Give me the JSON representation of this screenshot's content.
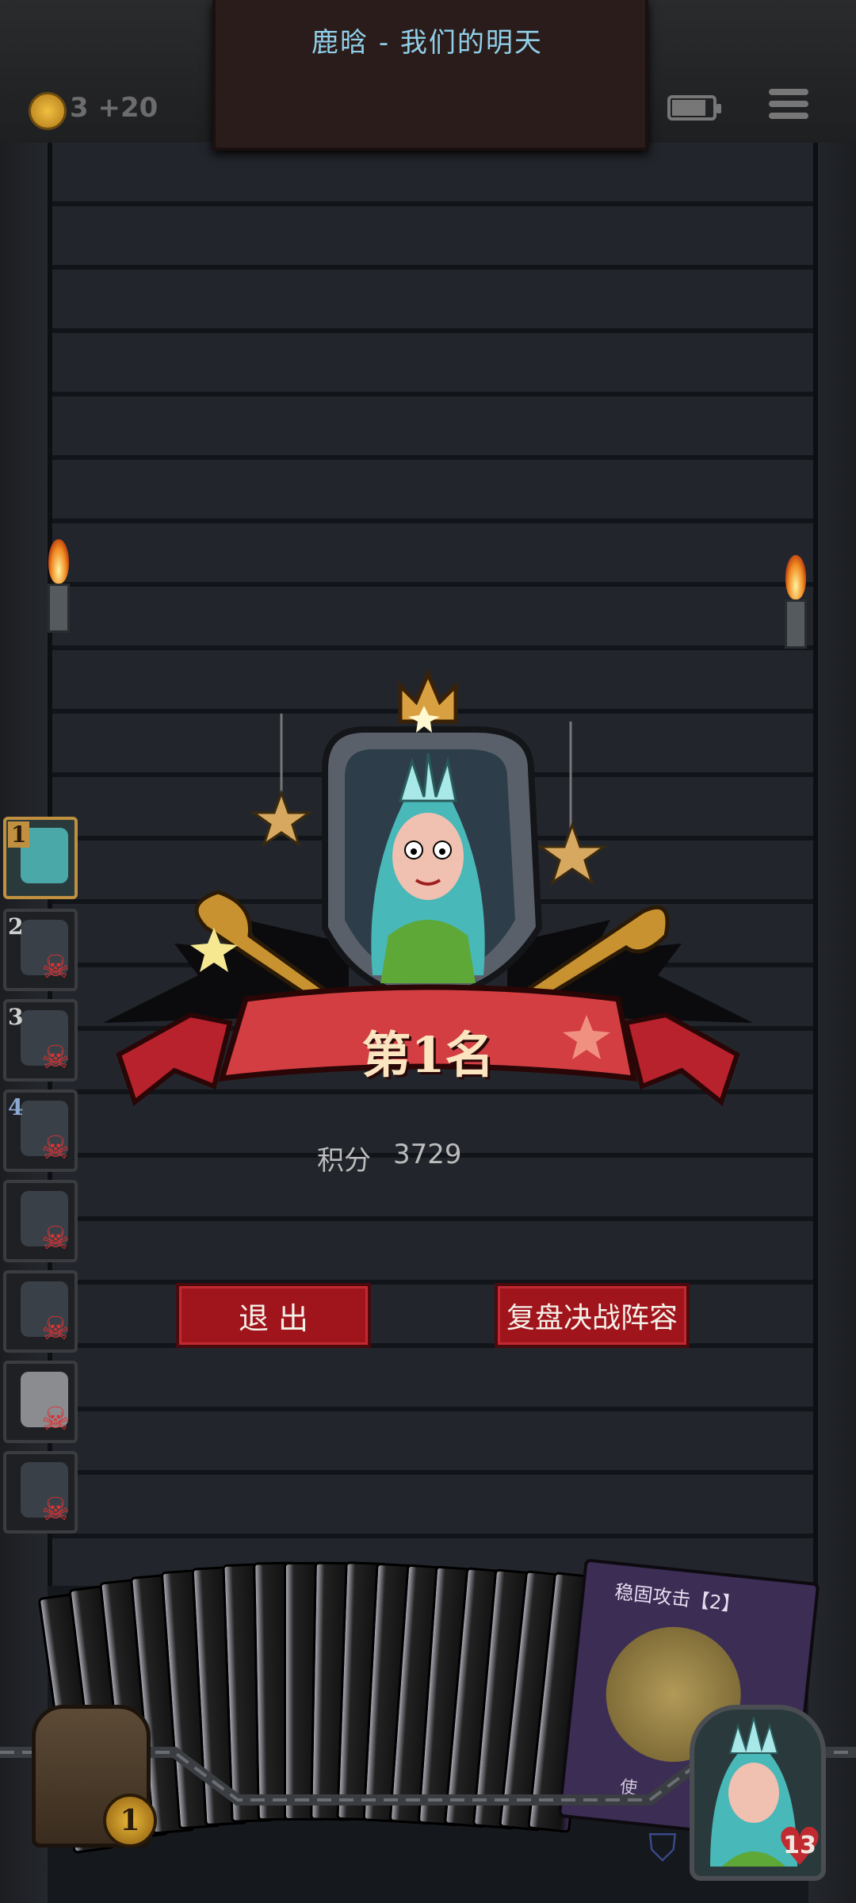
{
  "header": {
    "song_title": "鹿晗 - 我们的明天",
    "coins": "3",
    "coins_bonus": "+20"
  },
  "players": [
    {
      "rank": "1",
      "eliminated": false
    },
    {
      "rank": "2",
      "eliminated": true
    },
    {
      "rank": "3",
      "eliminated": true
    },
    {
      "rank": "4",
      "eliminated": true
    },
    {
      "rank": "",
      "eliminated": true
    },
    {
      "rank": "",
      "eliminated": true
    },
    {
      "rank": "",
      "eliminated": true
    },
    {
      "rank": "",
      "eliminated": true
    }
  ],
  "result": {
    "rank_title": "第1名",
    "score_label": "积分",
    "score_value": "3729"
  },
  "buttons": {
    "exit": "退 出",
    "review": "复盘决战阵容"
  },
  "card": {
    "title": "稳固攻击【2】",
    "text": "使"
  },
  "hud": {
    "chest_count": "1",
    "hp": "13"
  },
  "colors": {
    "accent_red": "#a0141c",
    "title_cyan": "#8fd0e8"
  }
}
